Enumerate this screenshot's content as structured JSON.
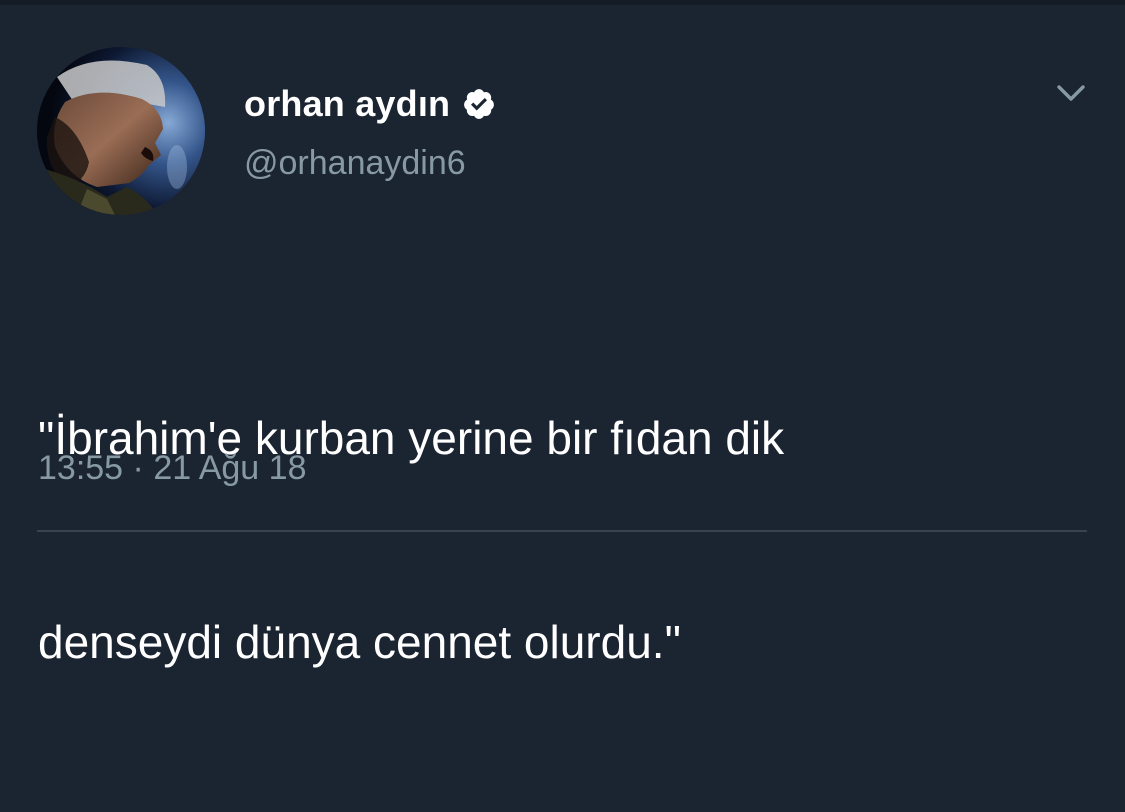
{
  "tweet": {
    "display_name": "orhan aydın",
    "handle": "@orhanaydin6",
    "text_lines": [
      "\"İbrahim'e kurban yerine bir fıdan dik",
      "denseydi dünya cennet olurdu.\""
    ],
    "time": "13:55",
    "separator": "·",
    "date": "21 Ağu 18"
  },
  "icons": {
    "verified": "verified-badge-icon",
    "menu": "chevron-down-icon"
  },
  "colors": {
    "background": "#1b2431",
    "text_primary": "#ffffff",
    "text_secondary": "#8899a6",
    "divider": "#38444d"
  }
}
